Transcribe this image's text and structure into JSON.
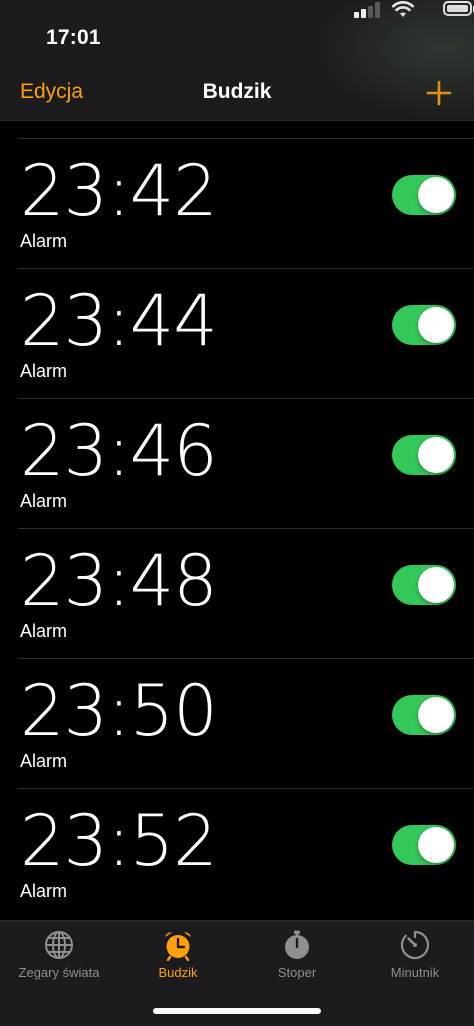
{
  "status": {
    "time": "17:01"
  },
  "nav": {
    "edit_label": "Edycja",
    "title": "Budzik"
  },
  "alarms": [
    {
      "time": "23:42",
      "label": "Alarm",
      "enabled": true
    },
    {
      "time": "23:44",
      "label": "Alarm",
      "enabled": true
    },
    {
      "time": "23:46",
      "label": "Alarm",
      "enabled": true
    },
    {
      "time": "23:48",
      "label": "Alarm",
      "enabled": true
    },
    {
      "time": "23:50",
      "label": "Alarm",
      "enabled": true
    },
    {
      "time": "23:52",
      "label": "Alarm",
      "enabled": true
    }
  ],
  "tabs": [
    {
      "label": "Zegary świata",
      "icon": "globe-icon",
      "active": false
    },
    {
      "label": "Budzik",
      "icon": "alarm-clock-icon",
      "active": true
    },
    {
      "label": "Stoper",
      "icon": "stopwatch-icon",
      "active": false
    },
    {
      "label": "Minutnik",
      "icon": "timer-icon",
      "active": false
    }
  ],
  "colors": {
    "accent": "#ff9f0a",
    "toggle_on": "#34c759",
    "inactive": "#8e8e93",
    "background": "#000000",
    "bar": "#1c1c1e"
  }
}
